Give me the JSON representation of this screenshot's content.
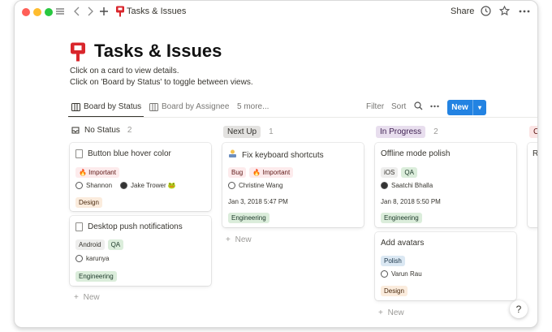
{
  "topbar": {
    "title": "Tasks & Issues",
    "share_label": "Share",
    "icons": [
      "menu-icon",
      "back-arrow-icon",
      "forward-arrow-icon",
      "plus-icon",
      "clock-icon",
      "star-icon",
      "more-icon"
    ]
  },
  "page": {
    "title": "Tasks & Issues",
    "description_line1": "Click on a card to view details.",
    "description_line2": "Click on 'Board by Status' to toggle between views."
  },
  "views": {
    "tabs": [
      "Board by Status",
      "Board by Assignee",
      "5 more..."
    ],
    "filter_label": "Filter",
    "sort_label": "Sort",
    "new_label": "New"
  },
  "columns": [
    {
      "name": "No Status",
      "count": "2",
      "cards": [
        {
          "title": "Button blue hover color",
          "tags": [
            "🔥 Important"
          ],
          "assignees": [
            "Shannon",
            "Jake Trower 🐸"
          ],
          "extra_tag": "Design"
        },
        {
          "title": "Desktop push notifications",
          "tags": [
            "Android",
            "QA"
          ],
          "assignees": [
            "karunya"
          ],
          "extra_tag": "Engineering"
        }
      ],
      "new_label": "New"
    },
    {
      "name": "Next Up",
      "count": "1",
      "cards": [
        {
          "title": "Fix keyboard shortcuts",
          "tags": [
            "Bug",
            "🔥 Important"
          ],
          "assignees": [
            "Christine Wang"
          ],
          "date": "Jan 3, 2018 5:47 PM",
          "extra_tag": "Engineering"
        }
      ],
      "new_label": "New"
    },
    {
      "name": "In Progress",
      "count": "2",
      "cards": [
        {
          "title": "Offline mode polish",
          "tags": [
            "iOS",
            "QA"
          ],
          "assignees": [
            "Saatchi Bhalla"
          ],
          "date": "Jan 8, 2018 5:50 PM",
          "extra_tag": "Engineering"
        },
        {
          "title": "Add avatars",
          "tags": [
            "Polish"
          ],
          "assignees": [
            "Varun Rau"
          ],
          "extra_tag": "Design"
        }
      ],
      "new_label": "New"
    },
    {
      "name": "C",
      "cards": [
        {
          "title": "Re"
        }
      ]
    }
  ],
  "help_label": "?"
}
